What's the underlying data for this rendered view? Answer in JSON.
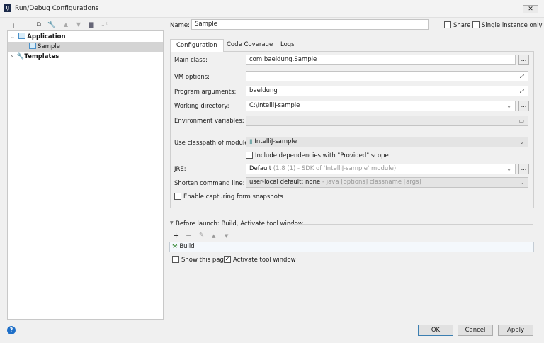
{
  "window": {
    "title": "Run/Debug Configurations",
    "logo": "IJ"
  },
  "toolbar": {
    "icons": [
      "plus-icon",
      "minus-icon",
      "copy-icon",
      "wrench-icon",
      "arrow-up-icon",
      "arrow-down-icon",
      "folder-icon",
      "sort-icon"
    ]
  },
  "tree": {
    "application": "Application",
    "sample": "Sample",
    "templates": "Templates"
  },
  "header": {
    "name_label": "Name:",
    "name_value": "Sample",
    "share": "Share",
    "single_instance": "Single instance only"
  },
  "tabs": [
    "Configuration",
    "Code Coverage",
    "Logs"
  ],
  "form": {
    "main_class_label": "Main class:",
    "main_class": "com.baeldung.Sample",
    "vm_options_label": "VM options:",
    "vm_options": "",
    "program_args_label": "Program arguments:",
    "program_args": "baeldung",
    "working_dir_label": "Working directory:",
    "working_dir": "C:\\IntelliJ-sample",
    "env_vars_label": "Environment variables:",
    "classpath_label": "Use classpath of module:",
    "classpath": "IntelliJ-sample",
    "include_provided": "Include dependencies with \"Provided\" scope",
    "jre_label": "JRE:",
    "jre_main": "Default",
    "jre_detail": "(1.8 (1) - SDK of 'IntelliJ-sample' module)",
    "shorten_label": "Shorten command line:",
    "shorten_main": "user-local default: none",
    "shorten_detail": "- java [options] classname [args]",
    "snapshots": "Enable capturing form snapshots",
    "ellipsis": "..."
  },
  "before_launch": {
    "title": "Before launch: Build, Activate tool window",
    "item": "Build",
    "show_page": "Show this page",
    "activate": "Activate tool window",
    "activate_checked": true
  },
  "buttons": {
    "help": "?",
    "ok": "OK",
    "cancel": "Cancel",
    "apply": "Apply"
  }
}
